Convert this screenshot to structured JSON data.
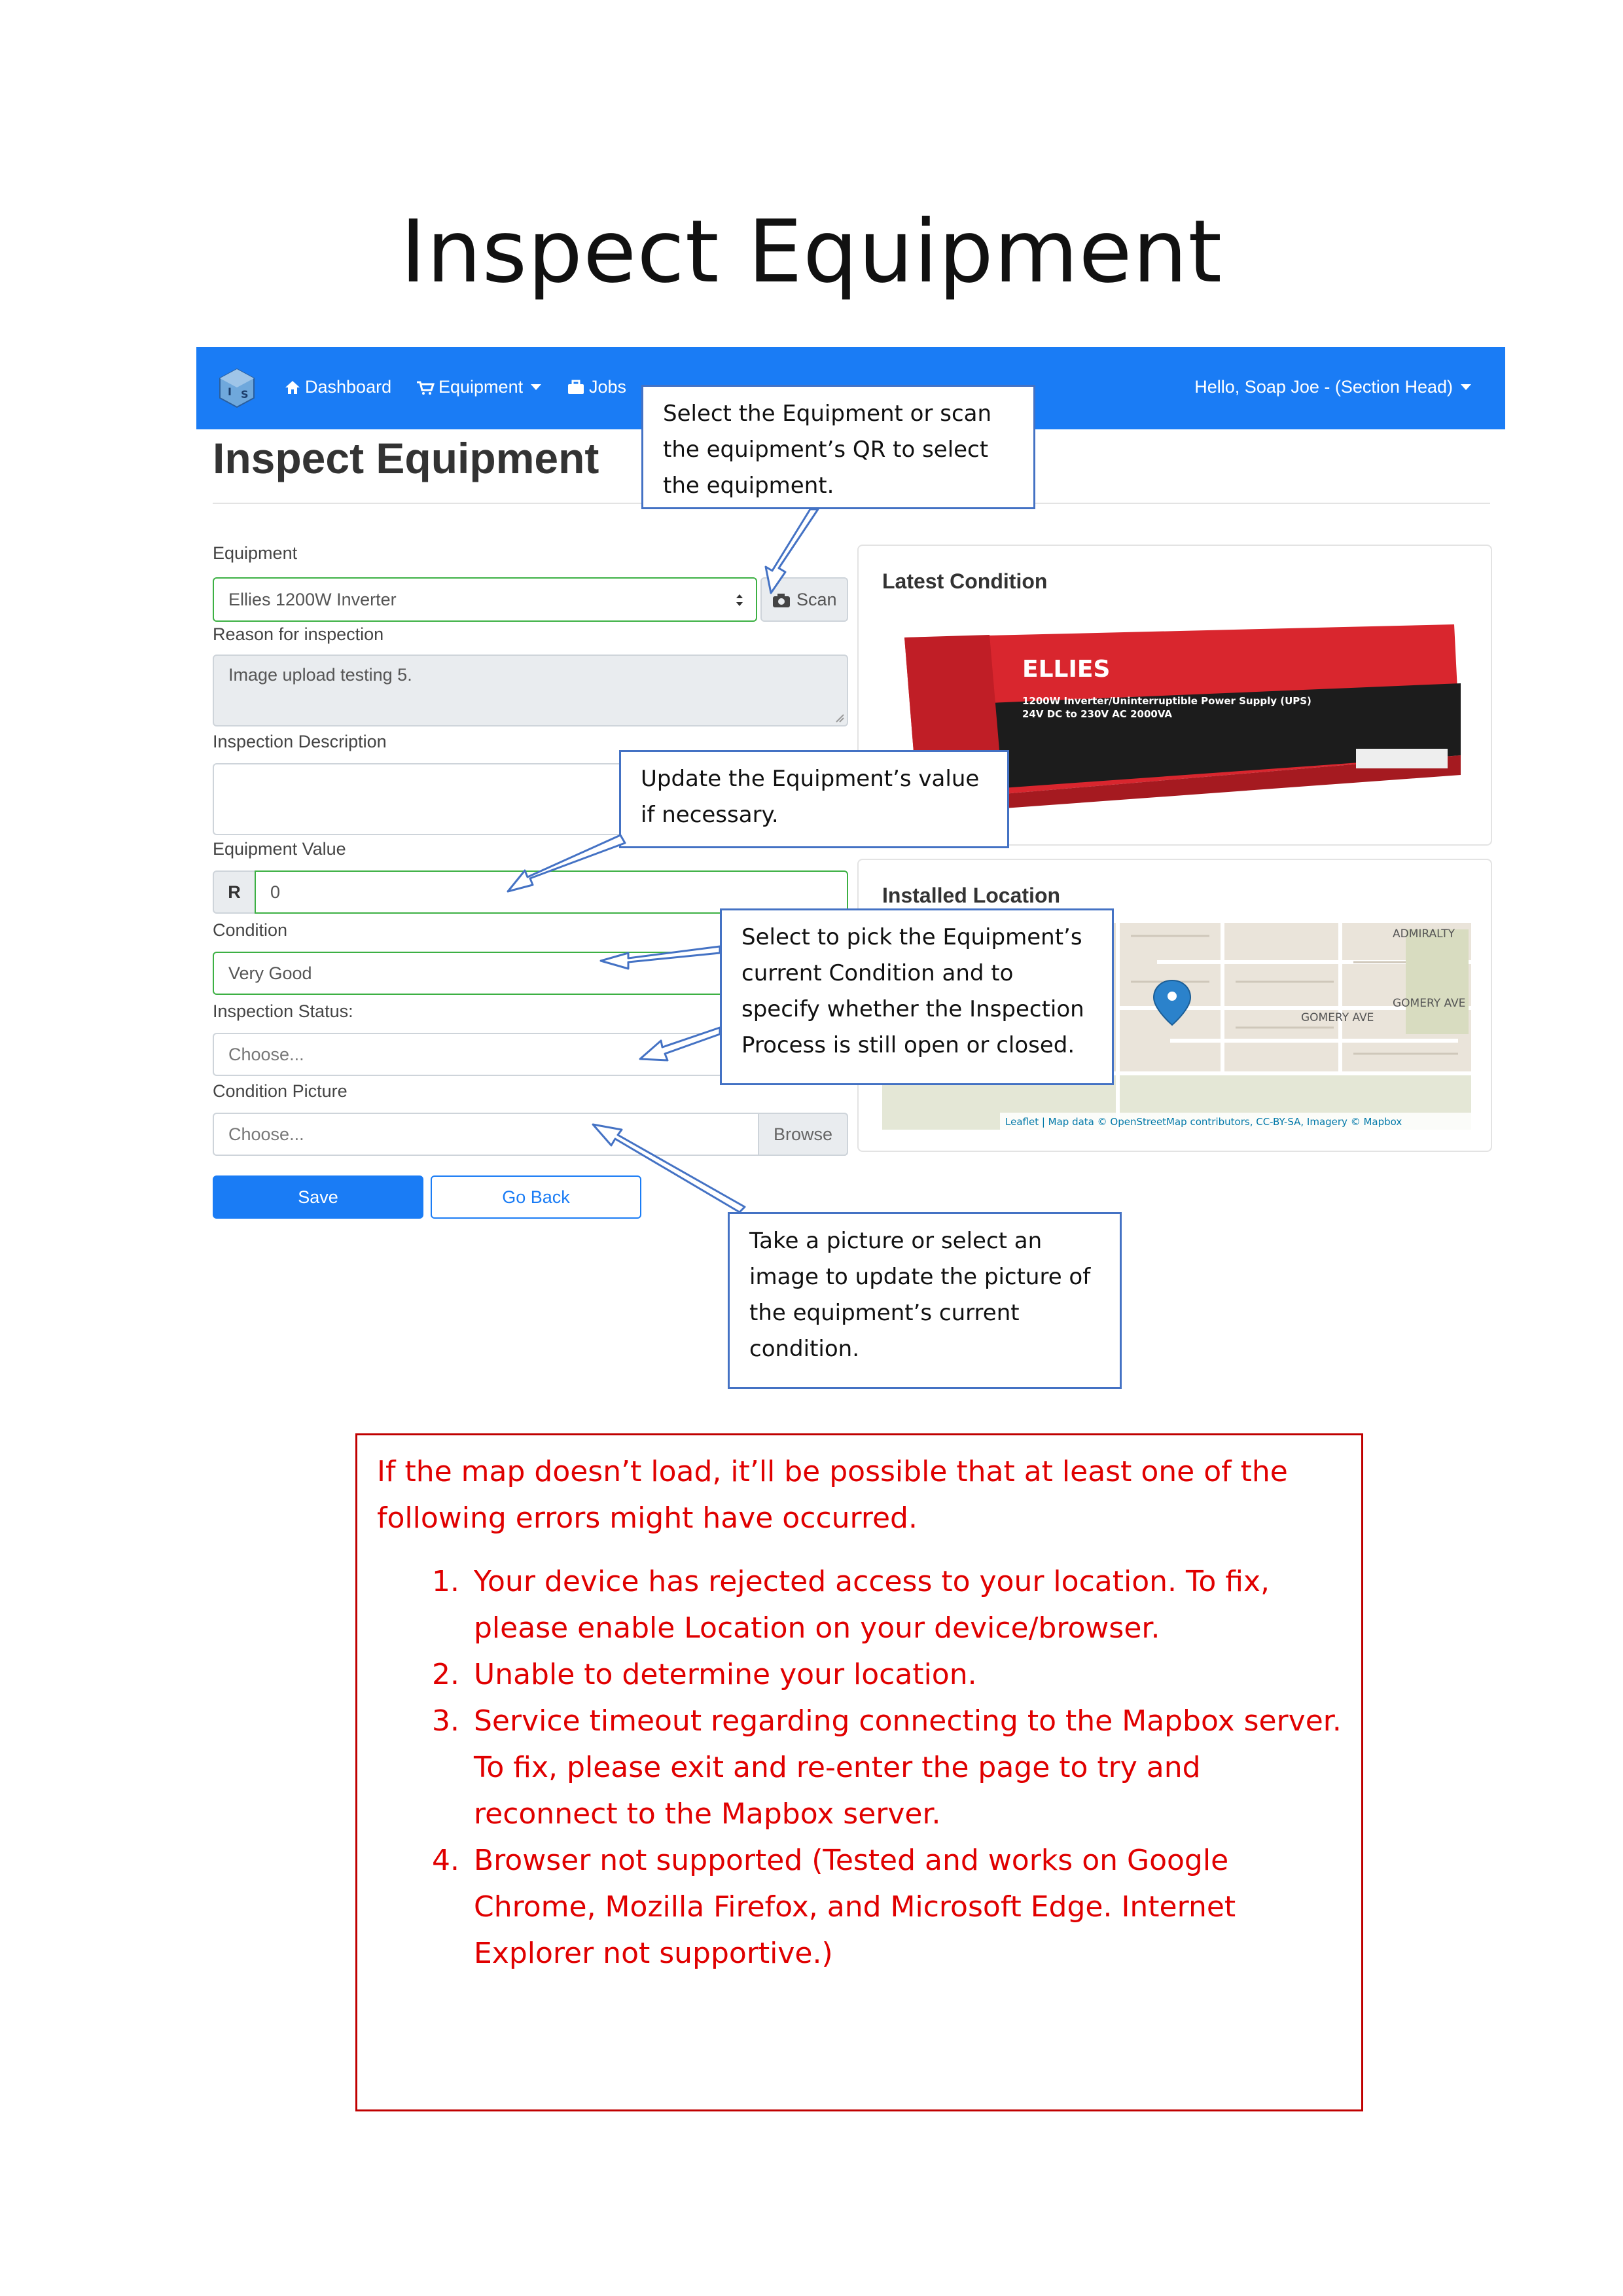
{
  "document_title": "Inspect Equipment",
  "navbar": {
    "dashboard": "Dashboard",
    "equipment": "Equipment",
    "jobs": "Jobs",
    "user": "Hello, Soap Joe - (Section Head)",
    "color": "#1a7cf5"
  },
  "page_heading": "Inspect Equipment",
  "form": {
    "equipment_label": "Equipment",
    "equipment_value": "Ellies 1200W Inverter",
    "scan_button": "Scan",
    "reason_label": "Reason for inspection",
    "reason_value": "Image upload testing 5.",
    "description_label": "Inspection Description",
    "value_label": "Equipment Value",
    "currency": "R",
    "value": "0",
    "condition_label": "Condition",
    "condition_value": "Very Good",
    "status_label": "Inspection Status:",
    "status_placeholder": "Choose...",
    "picture_label": "Condition Picture",
    "picture_placeholder": "Choose...",
    "browse_button": "Browse",
    "save_button": "Save",
    "back_button": "Go Back"
  },
  "latest_condition": {
    "title": "Latest Condition",
    "product_brand": "ELLIES",
    "product_text_1": "1200W Inverter/Uninterruptible Power Supply (UPS)",
    "product_text_2": "24V DC to 230V AC 2000VA"
  },
  "installed_location": {
    "title": "Installed Location",
    "street_1": "ADMIRALTY",
    "street_2": "GOMERY AVE",
    "street_3": "GOMERY AVE",
    "attribution": "Leaflet | Map data © OpenStreetMap contributors, CC-BY-SA, Imagery © Mapbox"
  },
  "callouts": {
    "equipment": "Select the Equipment or scan the equipment’s QR to select the equipment.",
    "value": "Update the Equipment’s value if necessary.",
    "condition": "Select to pick the Equipment’s current Condition and to specify whether the Inspection Process is still open or closed.",
    "picture": "Take a picture or select an image to update the picture of the equipment’s current condition."
  },
  "errors": {
    "intro": "If the map doesn’t load, it’ll be possible that at least one of the following errors might have occurred.",
    "items": [
      "Your device has rejected access to your location. To fix, please enable Location on your device/browser.",
      "Unable to determine your location.",
      "Service timeout regarding connecting to the Mapbox server. To fix, please exit and re-enter the page to try and reconnect to the Mapbox server.",
      "Browser not supported (Tested and works on Google Chrome, Mozilla Firefox, and Microsoft Edge. Internet Explorer not supportive.)"
    ],
    "color": "#e00000"
  }
}
